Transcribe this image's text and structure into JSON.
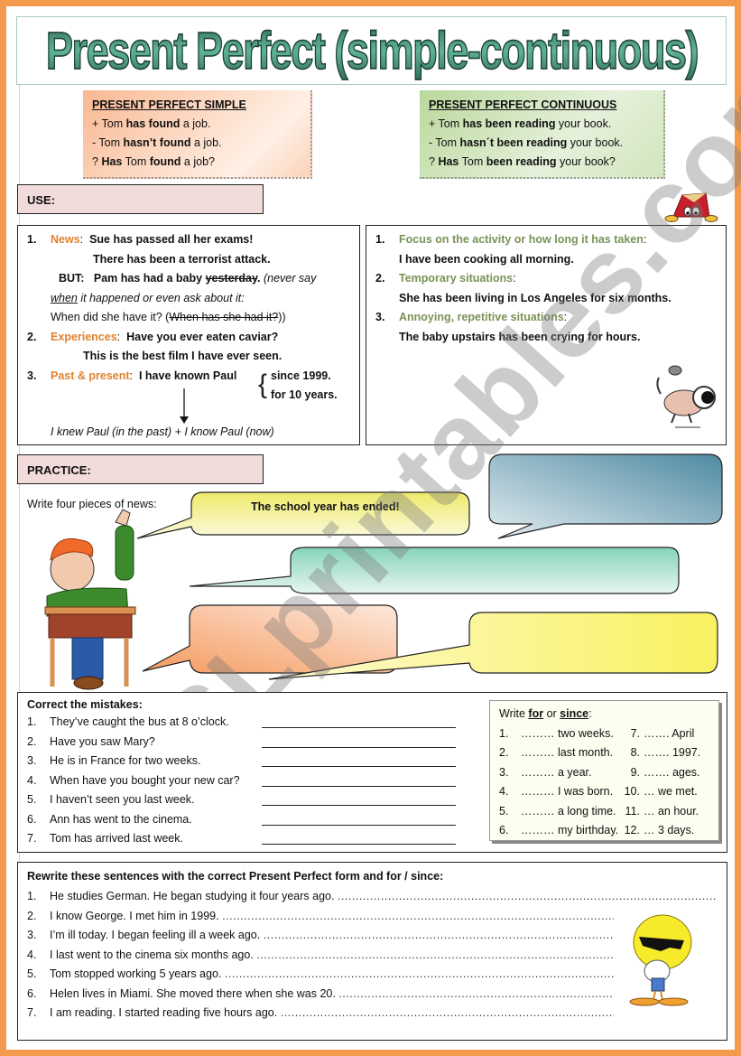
{
  "title": "Present Perfect (simple-continuous)",
  "forms": {
    "simple": {
      "heading": "PRESENT PERFECT SIMPLE",
      "lines": [
        {
          "prefix": "+ Tom ",
          "bold": "has found",
          "suffix": " a job."
        },
        {
          "prefix": "- Tom ",
          "bold": "hasn’t found",
          "suffix": " a job."
        },
        {
          "prefix": "? ",
          "bold": "Has",
          "mid": " Tom ",
          "bold2": "found",
          "suffix": " a job?"
        }
      ]
    },
    "continuous": {
      "heading": "PRESENT PERFECT CONTINUOUS",
      "lines": [
        {
          "prefix": "+ Tom ",
          "bold": "has been reading",
          "suffix": " your book."
        },
        {
          "prefix": "- Tom ",
          "bold": "hasn´t been reading",
          "suffix": " your book."
        },
        {
          "prefix": "? ",
          "bold": "Has",
          "mid": " Tom ",
          "bold2": "been reading",
          "suffix": " your book?"
        }
      ]
    }
  },
  "use": {
    "label": "USE:",
    "simple": {
      "item1": {
        "num": "1.",
        "label": "News",
        "ex1": "Sue has passed all her exams!",
        "ex2": "There has been a terrorist attack.",
        "but": "BUT:",
        "ex3": "Pam has had a baby ",
        "ex3_strike": "yesterday",
        "ex3_end": ".",
        "note1": " (never say",
        "note_when": "when",
        "note2": " it happened  or even ask about it:",
        "note3": "When did she have it?  (",
        "note3_strike": "When has she had it?",
        "note3_end": "))"
      },
      "item2": {
        "num": "2.",
        "label": "Experiences",
        "ex1": "Have you ever eaten caviar?",
        "ex2": "This is the best film I have ever seen."
      },
      "item3": {
        "num": "3.",
        "label": "Past & present",
        "ex1": "I have known Paul",
        "opt1": "since 1999.",
        "opt2": "for 10 years.",
        "explanation": "I knew Paul (in the past) + I know Paul (now)"
      }
    },
    "continuous": {
      "items": [
        {
          "num": "1.",
          "label": "Focus on the activity or how long it has taken",
          "example": "I have been cooking all morning."
        },
        {
          "num": "2.",
          "label": "Temporary situations",
          "example": "She has been living in Los Angeles for six months."
        },
        {
          "num": "3.",
          "label": "Annoying, repetitive situations",
          "example": "The baby upstairs has been crying for hours."
        }
      ]
    }
  },
  "practice": {
    "label": "PRACTICE:",
    "instruction": "Write four pieces of news:",
    "example_bubble": "The school year has ended!",
    "bubble_colors": {
      "yellow": "#f3f09a",
      "blue": "#6e9fb3",
      "teal": "#9fd8c4",
      "orange": "#f6b187",
      "lightyellow": "#fbf78a"
    }
  },
  "correct_mistakes": {
    "title": "Correct the mistakes:",
    "items": [
      {
        "num": "1.",
        "text": "They’ve caught the bus at 8 o’clock."
      },
      {
        "num": "2.",
        "text": "Have you saw Mary?"
      },
      {
        "num": "3.",
        "text": "He is in France for two weeks."
      },
      {
        "num": "4.",
        "text": "When have you bought your new car?"
      },
      {
        "num": "5.",
        "text": "I haven’t seen you last week."
      },
      {
        "num": "6.",
        "text": "Ann has went to the cinema."
      },
      {
        "num": "7.",
        "text": "Tom has arrived last week."
      }
    ]
  },
  "for_since": {
    "title_pre": "Write ",
    "title_for": "for",
    "title_mid": " or ",
    "title_since": "since",
    "title_end": ":",
    "rows": [
      {
        "n1": "1.",
        "t1": "……… two weeks.",
        "n2": "7.",
        "t2": "……. April"
      },
      {
        "n1": "2.",
        "t1": "……… last month.",
        "n2": "8.",
        "t2": "……. 1997."
      },
      {
        "n1": "3.",
        "t1": "……… a year.",
        "n2": "9.",
        "t2": "……. ages."
      },
      {
        "n1": "4.",
        "t1": "……… I was born.",
        "n2": "10.",
        "t2": "… we met."
      },
      {
        "n1": "5.",
        "t1": "……… a long time.",
        "n2": "11.",
        "t2": "… an hour."
      },
      {
        "n1": "6.",
        "t1": "……… my birthday.",
        "n2": "12.",
        "t2": "… 3 days."
      }
    ]
  },
  "rewrite": {
    "title": "Rewrite these sentences with the correct Present Perfect form and for / since:",
    "items": [
      {
        "num": "1.",
        "text": "He studies German. He began studying it four years ago."
      },
      {
        "num": "2.",
        "text": "I know George. I met him in 1999."
      },
      {
        "num": "3.",
        "text": "I’m ill today. I began feeling ill a week ago."
      },
      {
        "num": "4.",
        "text": "I last went to the cinema six months ago."
      },
      {
        "num": "5.",
        "text": "Tom stopped working 5 years ago."
      },
      {
        "num": "6.",
        "text": "Helen lives in Miami. She moved there when she was 20."
      },
      {
        "num": "7.",
        "text": "I am reading. I started reading five hours ago."
      }
    ]
  },
  "watermark": "ESLprintables.com",
  "colors": {
    "border": "#f39a4c",
    "title": "#3f8a70",
    "label_bg": "#f2dcdb",
    "orange_label": "#e0822f",
    "olive_label": "#7a9256"
  }
}
